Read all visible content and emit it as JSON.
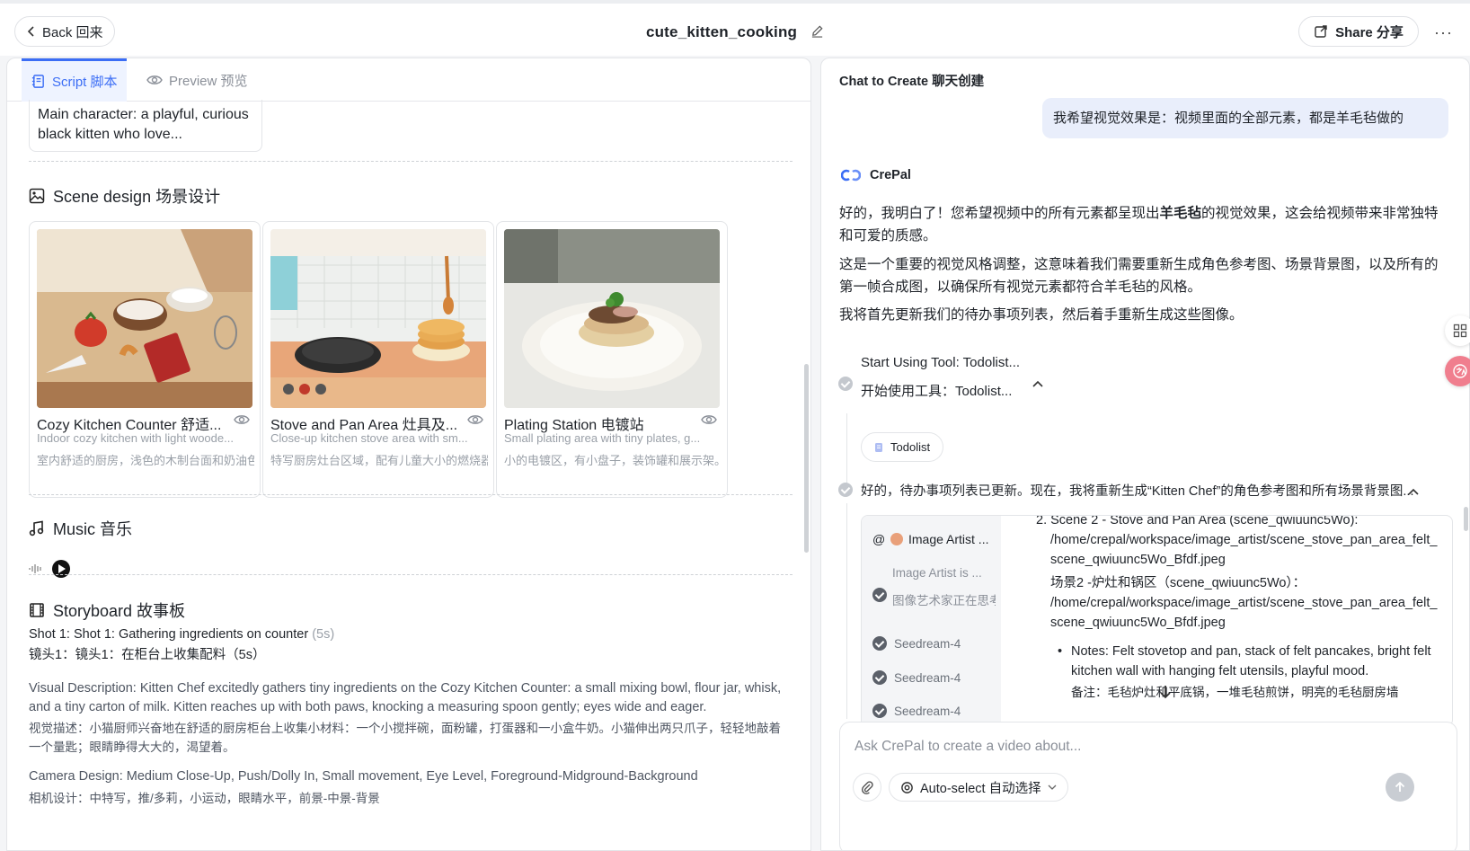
{
  "header": {
    "back_label": "Back 回来",
    "title": "cute_kitten_cooking",
    "share_label": "Share 分享",
    "more": "···"
  },
  "tabs": [
    {
      "label": "Script 脚本"
    },
    {
      "label": "Preview 预览"
    }
  ],
  "character": {
    "desc": "Main character: a playful, curious black kitten who love..."
  },
  "scene_design": {
    "heading": "Scene design 场景设计",
    "scenes": [
      {
        "title": "Cozy Kitchen Counter 舒适...",
        "desc_en": "Indoor cozy kitchen with light woode...",
        "desc_cn": "室内舒适的厨房，浅色的木制台面和奶油色"
      },
      {
        "title": "Stove and Pan Area 灶具及...",
        "desc_en": "Close-up kitchen stove area with sm...",
        "desc_cn": "特写厨房灶台区域，配有儿童大小的燃烧器"
      },
      {
        "title": "Plating Station 电镀站",
        "desc_en": "Small plating area with tiny plates, g...",
        "desc_cn": "小的电镀区，有小盘子，装饰罐和展示架。"
      }
    ]
  },
  "music": {
    "heading": "Music 音乐"
  },
  "storyboard": {
    "heading": "Storyboard 故事板",
    "shot_title": "Shot 1: Shot 1: Gathering ingredients on counter",
    "shot_duration": "(5s)",
    "shot_cn": "镜头1：镜头1：在柜台上收集配料（5s）",
    "visual_en": "Visual Description: Kitten Chef excitedly gathers tiny ingredients on the Cozy Kitchen Counter: a small mixing bowl, flour jar, whisk, and a tiny carton of milk. Kitten reaches up with both paws, knocking a measuring spoon gently; eyes wide and eager.",
    "visual_cn": "视觉描述：小猫厨师兴奋地在舒适的厨房柜台上收集小材料：一个小搅拌碗，面粉罐，打蛋器和一小盒牛奶。小猫伸出两只爪子，轻轻地敲着一个量匙；眼睛睁得大大的，渴望着。",
    "camera_en": "Camera Design: Medium Close-Up, Push/Dolly In, Small movement, Eye Level, Foreground-Midground-Background",
    "camera_cn": "相机设计：中特写，推/多莉，小运动，眼睛水平，前景-中景-背景"
  },
  "chat": {
    "heading": "Chat to Create 聊天创建",
    "user_msg": "我希望视觉效果是：视频里面的全部元素，都是羊毛毡做的",
    "bot_name": "CrePal",
    "bot_p1_a": "好的，我明白了！您希望视频中的所有元素都呈现出",
    "bot_p1_b": "羊毛毡",
    "bot_p1_c": "的视觉效果，这会给视频带来非常独特和可爱的质感。",
    "bot_p2": "这是一个重要的视觉风格调整，这意味着我们需要重新生成角色参考图、场景背景图，以及所有的第一帧合成图，以确保所有视觉元素都符合羊毛毡的风格。",
    "bot_p3": "我将首先更新我们的待办事项列表，然后着手重新生成这些图像。",
    "tool_en": "Start Using Tool: Todolist...",
    "tool_cn": "开始使用工具：Todolist...",
    "todolist_chip": "Todolist",
    "status": "好的，待办事项列表已更新。现在，我将重新生成“Kitten Chef”的角色参考图和所有场景背景图...",
    "artist": {
      "head": "Image Artist ...",
      "sub_en": "Image Artist is ...",
      "sub_cn": "图像艺术家正在思考",
      "seeds": [
        "Seedream-4",
        "Seedream-4",
        "Seedream-4"
      ],
      "scene_line_1": "2. Scene 2 - Stove and Pan Area (scene_qwiuunc5Wo):",
      "scene_path_1": "/home/crepal/workspace/image_artist/scene_stove_pan_area_felt_scene_qwiuunc5Wo_Bfdf.jpeg",
      "scene_line_2": "场景2 -炉灶和锅区（scene_qwiuunc5Wo）：",
      "scene_path_2": "/home/crepal/workspace/image_artist/scene_stove_pan_area_felt_scene_qwiuunc5Wo_Bfdf.jpeg",
      "notes_en": "Notes: Felt stovetop and pan, stack of felt pancakes, bright felt kitchen wall with hanging felt utensils, playful mood.",
      "notes_cn": "备注：毛毡炉灶和平底锅，一堆毛毡煎饼，明亮的毛毡厨房墙"
    },
    "input_placeholder": "Ask CrePal to create a video about...",
    "auto_select": "Auto-select 自动选择"
  },
  "colors": {
    "accent": "#3b6df5",
    "user_bubble": "#e9eefb"
  }
}
